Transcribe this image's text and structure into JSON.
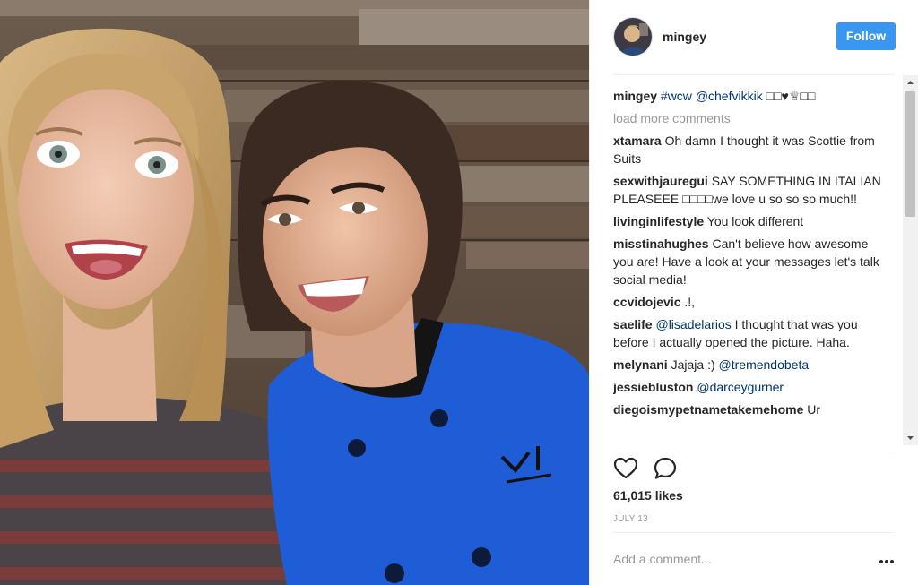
{
  "post": {
    "username": "mingey",
    "follow_label": "Follow",
    "caption": {
      "user": "mingey",
      "hashtag": "#wcw",
      "mention": "@chefvikkik",
      "emoji": "□□♥♕□□"
    },
    "load_more_label": "load more comments",
    "comments": [
      {
        "user": "xtamara",
        "pre": "Oh damn I thought it was Scottie from Suits",
        "mention": "",
        "post": ""
      },
      {
        "user": "sexwithjauregui",
        "pre": "SAY SOMETHING IN ITALIAN PLEASEEE □□□□we love u so so so much!!",
        "mention": "",
        "post": ""
      },
      {
        "user": "livinginlifestyle",
        "pre": "You look different",
        "mention": "",
        "post": ""
      },
      {
        "user": "misstinahughes",
        "pre": "Can't believe how awesome you are! Have a look at your messages let's talk social media!",
        "mention": "",
        "post": ""
      },
      {
        "user": "ccvidojevic",
        "pre": ".!,",
        "mention": "",
        "post": ""
      },
      {
        "user": "saelife",
        "pre": "",
        "mention": "@lisadelarios",
        "post": "I thought that was you before I actually opened the picture. Haha."
      },
      {
        "user": "melynani",
        "pre": "Jajaja :)",
        "mention": "@tremendobeta",
        "post": ""
      },
      {
        "user": "jessiebluston",
        "pre": "",
        "mention": "@darceygurner",
        "post": ""
      },
      {
        "user": "diegoismypetnametakemehome",
        "pre": "Ur",
        "mention": "",
        "post": ""
      }
    ],
    "likes": "61,015 likes",
    "date": "JULY 13",
    "add_comment_placeholder": "Add a comment...",
    "icons": {
      "like": "heart-icon",
      "comment": "speech-bubble-icon",
      "more": "more-options-icon"
    },
    "colors": {
      "follow_bg": "#3897f0",
      "mention": "#003569",
      "muted": "#999999"
    }
  }
}
